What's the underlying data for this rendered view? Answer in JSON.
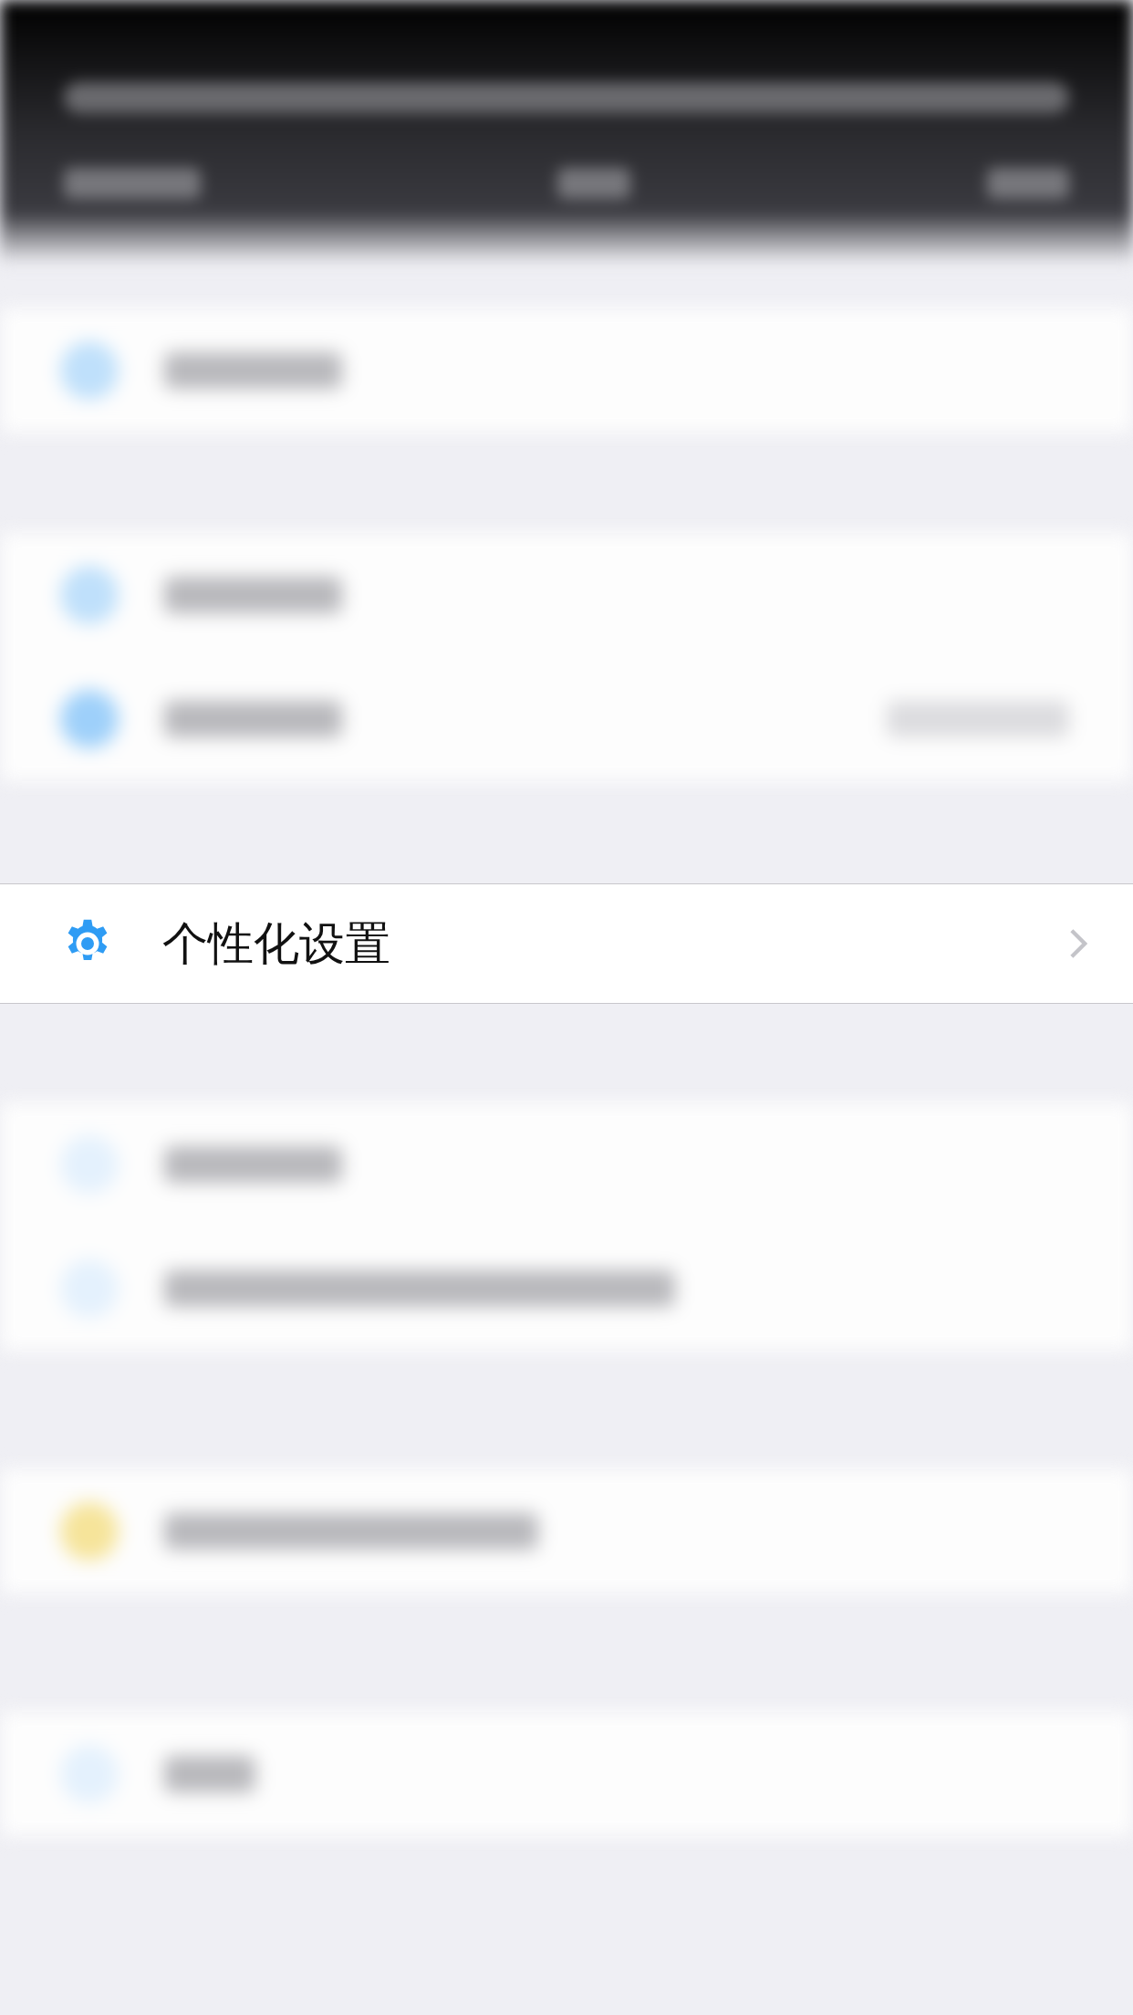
{
  "focused_row": {
    "label": "个性化设置"
  }
}
